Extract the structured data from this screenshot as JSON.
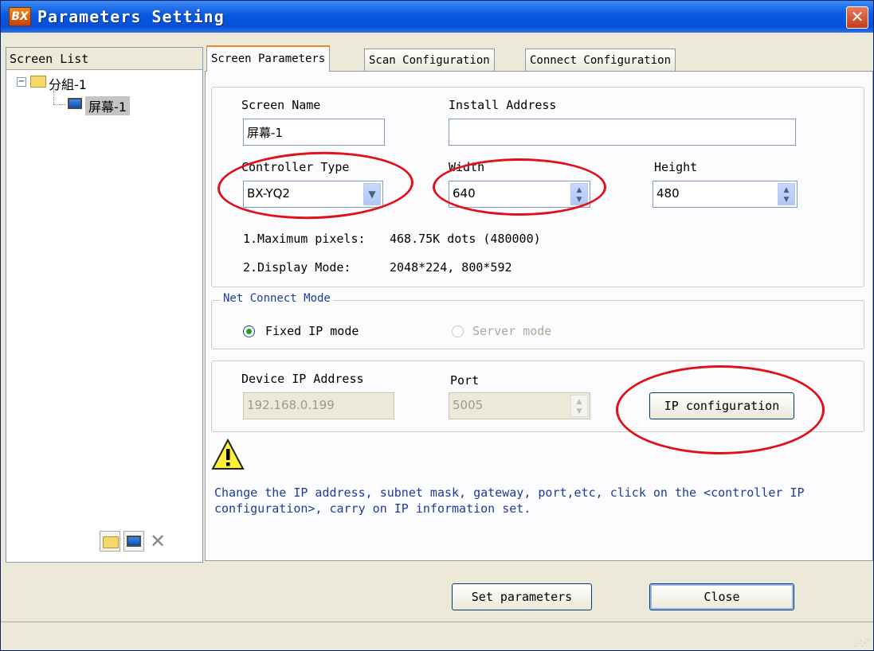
{
  "window": {
    "title": "Parameters Setting",
    "app_icon": "BX"
  },
  "screen_list": {
    "header": "Screen List",
    "group": "分組-1",
    "screen": "屏幕-1",
    "expand_symbol": "−"
  },
  "tabs": [
    {
      "label": "Screen Parameters",
      "active": true
    },
    {
      "label": "Scan Configuration",
      "active": false
    },
    {
      "label": "Connect Configuration",
      "active": false
    }
  ],
  "screen_params": {
    "screen_name_label": "Screen Name",
    "screen_name_value": "屏幕-1",
    "install_address_label": "Install Address",
    "install_address_value": "",
    "controller_type_label": "Controller Type",
    "controller_type_value": "BX-YQ2",
    "width_label": "Width",
    "width_value": "640",
    "height_label": "Height",
    "height_value": "480",
    "info_max_pixels_label": "1.Maximum pixels:",
    "info_max_pixels_value": "468.75K dots (480000)",
    "info_display_mode_label": "2.Display Mode:",
    "info_display_mode_value": "2048*224, 800*592"
  },
  "net_connect": {
    "legend": "Net Connect Mode",
    "fixed_ip_label": "Fixed IP mode",
    "server_mode_label": "Server mode"
  },
  "device": {
    "ip_label": "Device IP Address",
    "ip_value": "192.168.0.199",
    "port_label": "Port",
    "port_value": "5005",
    "ip_config_button": "IP configuration"
  },
  "note": "Change the IP address, subnet mask, gateway, port,etc, click on the <controller IP configuration>, carry on IP information set.",
  "footer": {
    "set_parameters_button": "Set parameters",
    "close_button": "Close"
  },
  "colors": {
    "annotation_red": "#e0111a",
    "titlebar_blue": "#0858e0"
  }
}
